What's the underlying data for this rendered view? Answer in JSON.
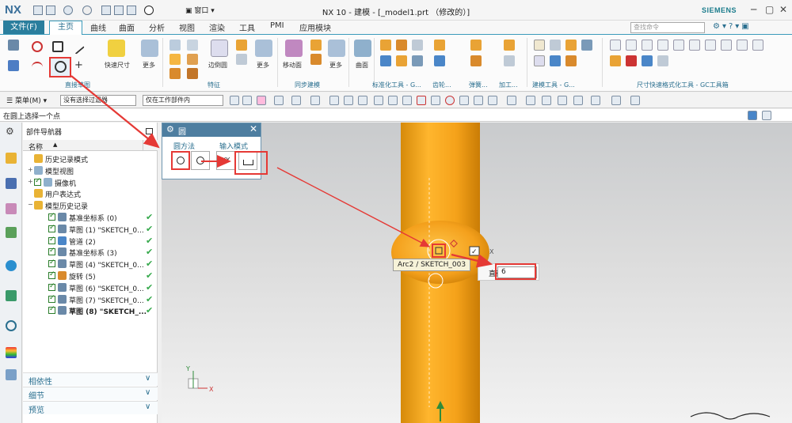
{
  "window": {
    "app_logo": "NX",
    "title": "NX 10 - 建模 - [_model1.prt （修改的）]",
    "window_menu": "窗口",
    "brand": "SIEMENS"
  },
  "ribbon": {
    "file_tab": "文件(F)",
    "tabs": [
      "主页",
      "曲线",
      "曲面",
      "分析",
      "视图",
      "渲染",
      "工具",
      "PMI",
      "应用模块"
    ],
    "search_placeholder": "查找命令",
    "buttons": {
      "quick_dimension": "快速尺寸",
      "more": "更多",
      "edge_blend": "边倒圆",
      "move_face": "移动面",
      "surface": "曲面"
    },
    "groups": [
      "直接草图",
      "特征",
      "同步建模",
      "标准化工具 - G...",
      "齿轮...",
      "弹簧...",
      "加工...",
      "建模工具 - G...",
      "尺寸快速格式化工具 - GC工具箱"
    ]
  },
  "selection_bar": {
    "menu": "菜单(M)",
    "filter": "没有选择过滤器",
    "scope": "仅在工作部件内"
  },
  "status": {
    "prompt": "在圆上选择一个点"
  },
  "navigator": {
    "title": "部件导航器",
    "column_name": "名称",
    "tree": [
      {
        "label": "历史记录模式",
        "indent": 1,
        "expander": "",
        "check": false,
        "ok": false
      },
      {
        "label": "模型视图",
        "indent": 1,
        "expander": "+",
        "check": false,
        "ok": false
      },
      {
        "label": "摄像机",
        "indent": 1,
        "expander": "+",
        "check": true,
        "ok": false
      },
      {
        "label": "用户表达式",
        "indent": 1,
        "expander": "",
        "check": false,
        "ok": false
      },
      {
        "label": "模型历史记录",
        "indent": 1,
        "expander": "−",
        "check": false,
        "ok": false
      },
      {
        "label": "基准坐标系 (0)",
        "indent": 2,
        "expander": "",
        "check": true,
        "ok": true
      },
      {
        "label": "草图 (1) \"SKETCH_0...",
        "indent": 2,
        "expander": "",
        "check": true,
        "ok": true
      },
      {
        "label": "管道 (2)",
        "indent": 2,
        "expander": "",
        "check": true,
        "ok": true
      },
      {
        "label": "基准坐标系 (3)",
        "indent": 2,
        "expander": "",
        "check": true,
        "ok": true
      },
      {
        "label": "草图 (4) \"SKETCH_0...",
        "indent": 2,
        "expander": "",
        "check": true,
        "ok": true
      },
      {
        "label": "旋转 (5)",
        "indent": 2,
        "expander": "",
        "check": true,
        "ok": true
      },
      {
        "label": "草图 (6) \"SKETCH_0...",
        "indent": 2,
        "expander": "",
        "check": true,
        "ok": true
      },
      {
        "label": "草图 (7) \"SKETCH_0...",
        "indent": 2,
        "expander": "",
        "check": true,
        "ok": true
      },
      {
        "label": "草图 (8) \"SKETCH_...",
        "indent": 2,
        "expander": "",
        "check": true,
        "ok": true
      }
    ],
    "sections": [
      "相依性",
      "细节",
      "预览"
    ]
  },
  "dialog": {
    "title": "圆",
    "group_method": "圆方法",
    "group_input": "输入模式"
  },
  "viewport": {
    "tooltip": "Arc2 / SKETCH_003",
    "diameter_label": "直径",
    "diameter_value": "6",
    "axis_x": "X",
    "axis_y": "Y"
  },
  "colors": {
    "accent": "#2a7e9d",
    "annotation": "#e53935",
    "model": "#f7a21b"
  }
}
